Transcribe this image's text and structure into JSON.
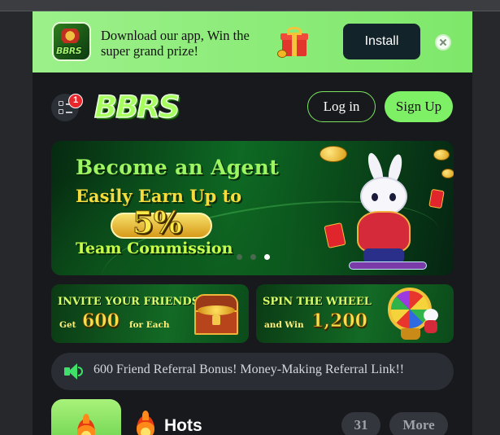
{
  "download_banner": {
    "text": "Download our app, Win the super grand prize!",
    "install_label": "Install",
    "app_icon_label": "BBRS"
  },
  "header": {
    "logo": "BBRS",
    "menu_badge": "1",
    "login_label": "Log in",
    "signup_label": "Sign Up"
  },
  "hero": {
    "line1": "Become an Agent",
    "line2": "Easily Earn Up to",
    "percent": "5%",
    "line3": "Team Commission",
    "slides": 3,
    "active_slide": 3
  },
  "promos": [
    {
      "title": "INVITE YOUR FRIENDS",
      "pre": "Get",
      "amount": "600",
      "post": "for Each"
    },
    {
      "title": "SPIN THE WHEEL",
      "pre": "and Win",
      "amount": "1,200",
      "post": ""
    }
  ],
  "marquee": {
    "text": "600 Friend Referral Bonus! Money-Making Referral Link!!"
  },
  "hots": {
    "title": "Hots",
    "count": "31",
    "more_label": "More"
  },
  "colors": {
    "accent_green": "#7ef066",
    "banner_green": "#9cf08a",
    "background": "#17191c",
    "badge_red": "#e8262c"
  },
  "icons": [
    "gift-icon",
    "close-icon",
    "menu-icon",
    "speaker-icon",
    "fire-icon"
  ]
}
